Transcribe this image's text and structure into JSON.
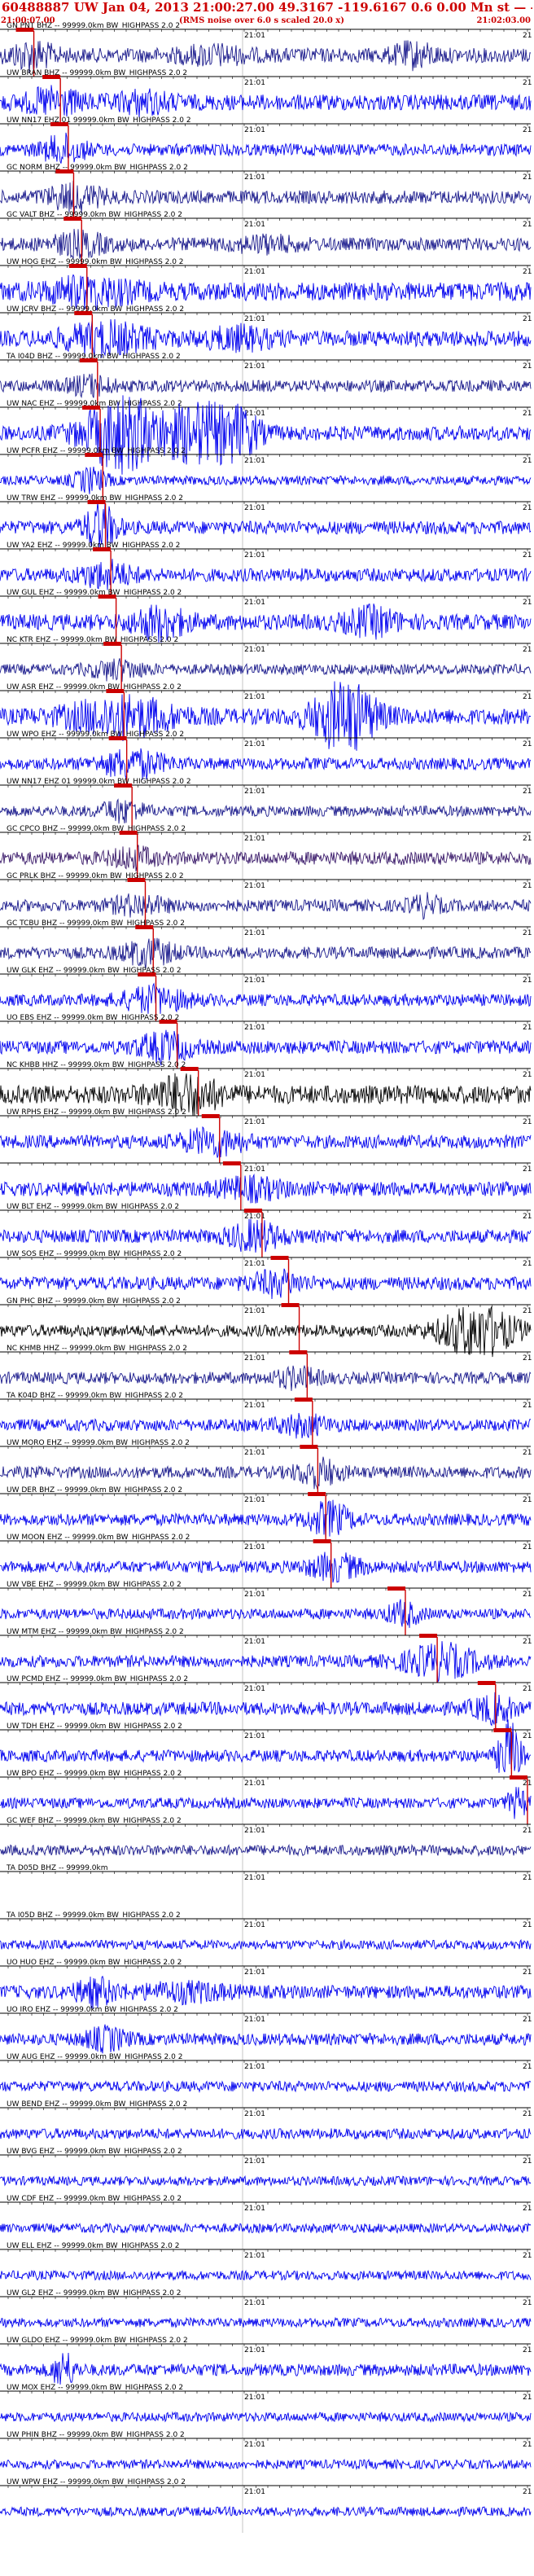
{
  "header": {
    "title": "60488887 UW Jan 04, 2013 21:00:27.00   49.3167 -119.6167  0.6 0.00 Mn st  — — —  -1",
    "time_start": "21:00:07.00",
    "note": "(RMS noise over 6.0 s scaled 20.0 x)",
    "time_end": "21:02:03.00"
  },
  "minute_label": "21:01",
  "minute_label_short": "21",
  "filter_suffix": "99999.0km BW_HIGHPASS  2.0  2",
  "colors": {
    "blue": "#0000ee",
    "navy": "#1a1a8c",
    "purple": "#3a1a6a",
    "black": "#000000",
    "pick": "#cc0000",
    "grid": "#888888"
  },
  "traces": [
    {
      "label": "GN PNT BHZ -- 99999.0km BW_HIGHPASS  2.0  2",
      "color": "navy",
      "amp": 0.55,
      "pick": 0.03,
      "bursts": [
        [
          0.06,
          0.9,
          0.04
        ],
        [
          0.4,
          0.5,
          0.06
        ],
        [
          0.78,
          0.7,
          0.04
        ]
      ],
      "header_only": false
    },
    {
      "label": "UW BRAN BHZ -- 99999.0km BW_HIGHPASS  2.0  2",
      "color": "blue",
      "amp": 0.6,
      "pick": 0.08,
      "bursts": [
        [
          0.1,
          0.8,
          0.05
        ],
        [
          0.27,
          0.6,
          0.05
        ]
      ],
      "header_only": false
    },
    {
      "label": "UW NN17 EHZ 01 99999.0km BW_HIGHPASS  2.0  2",
      "color": "blue",
      "amp": 0.45,
      "pick": 0.095,
      "bursts": [
        [
          0.12,
          0.9,
          0.04
        ]
      ],
      "header_only": false
    },
    {
      "label": "GC NORM BHZ -- 99999.0km BW_HIGHPASS  2.0  2",
      "color": "navy",
      "amp": 0.5,
      "pick": 0.105,
      "bursts": [
        [
          0.14,
          0.8,
          0.05
        ]
      ],
      "header_only": false
    },
    {
      "label": "GC VALT BHZ -- 99999.0km BW_HIGHPASS  2.0  2",
      "color": "navy",
      "amp": 0.5,
      "pick": 0.12,
      "bursts": [
        [
          0.15,
          0.7,
          0.05
        ],
        [
          0.5,
          0.4,
          0.06
        ]
      ],
      "header_only": false
    },
    {
      "label": "UW HOG EHZ -- 99999.0km BW_HIGHPASS  2.0  2",
      "color": "blue",
      "amp": 0.7,
      "pick": 0.13,
      "bursts": [
        [
          0.17,
          0.8,
          0.08
        ]
      ],
      "header_only": false
    },
    {
      "label": "UW JCRV BHZ -- 99999.0km BW_HIGHPASS  2.0  2",
      "color": "blue",
      "amp": 0.6,
      "pick": 0.14,
      "bursts": [
        [
          0.2,
          0.95,
          0.08
        ],
        [
          0.45,
          0.6,
          0.06
        ]
      ],
      "header_only": false
    },
    {
      "label": "TA I04D BHZ -- 99999.0km BW_HIGHPASS  2.0  2",
      "color": "navy",
      "amp": 0.45,
      "pick": 0.15,
      "bursts": [
        [
          0.17,
          0.6,
          0.04
        ]
      ],
      "header_only": false
    },
    {
      "label": "UW NAC EHZ -- 99999.0km BW_HIGHPASS  2.0  2",
      "color": "blue",
      "amp": 0.55,
      "pick": 0.155,
      "bursts": [
        [
          0.23,
          2.6,
          0.07
        ],
        [
          0.37,
          2.0,
          0.06
        ],
        [
          0.45,
          1.5,
          0.04
        ]
      ],
      "header_only": false
    },
    {
      "label": "UW PCFR EHZ -- 99999.0km BW_HIGHPASS  2.0  2",
      "color": "blue",
      "amp": 0.35,
      "pick": 0.16,
      "bursts": [
        [
          0.17,
          0.8,
          0.03
        ]
      ],
      "header_only": false
    },
    {
      "label": "UW TRW EHZ -- 99999.0km BW_HIGHPASS  2.0  2",
      "color": "blue",
      "amp": 0.5,
      "pick": 0.165,
      "bursts": [
        [
          0.19,
          1.6,
          0.03
        ]
      ],
      "header_only": false
    },
    {
      "label": "UW YA2 EHZ -- 99999.0km BW_HIGHPASS  2.0  2",
      "color": "blue",
      "amp": 0.5,
      "pick": 0.175,
      "bursts": [
        [
          0.2,
          0.8,
          0.05
        ]
      ],
      "header_only": false
    },
    {
      "label": "UW GUL EHZ -- 99999.0km BW_HIGHPASS  2.0  2",
      "color": "blue",
      "amp": 0.6,
      "pick": 0.185,
      "bursts": [
        [
          0.3,
          1.0,
          0.05
        ],
        [
          0.7,
          0.8,
          0.05
        ]
      ],
      "header_only": false
    },
    {
      "label": "NC KTR EHZ -- 99999.0km BW_HIGHPASS  2.0  2",
      "color": "navy",
      "amp": 0.4,
      "pick": 0.195,
      "bursts": [
        [
          0.22,
          0.6,
          0.05
        ]
      ],
      "header_only": false
    },
    {
      "label": "UW ASR EHZ -- 99999.0km BW_HIGHPASS  2.0  2",
      "color": "blue",
      "amp": 0.6,
      "pick": 0.2,
      "bursts": [
        [
          0.23,
          1.3,
          0.1
        ],
        [
          0.65,
          2.4,
          0.06
        ]
      ],
      "header_only": false
    },
    {
      "label": "UW WPO EHZ -- 99999.0km BW_HIGHPASS  2.0  2",
      "color": "blue",
      "amp": 0.45,
      "pick": 0.205,
      "bursts": [
        [
          0.25,
          0.9,
          0.06
        ]
      ],
      "header_only": false
    },
    {
      "label": "UW NN17 EHZ 01 99999.0km BW_HIGHPASS  2.0  2",
      "color": "navy",
      "amp": 0.4,
      "pick": 0.215,
      "bursts": [
        [
          0.23,
          0.7,
          0.04
        ]
      ],
      "header_only": false
    },
    {
      "label": "GC CPCO BHZ -- 99999.0km BW_HIGHPASS  2.0  2",
      "color": "purple",
      "amp": 0.5,
      "pick": 0.225,
      "bursts": [
        [
          0.25,
          0.6,
          0.04
        ]
      ],
      "header_only": false
    },
    {
      "label": "GC PRLK BHZ -- 99999.0km BW_HIGHPASS  2.0  2",
      "color": "navy",
      "amp": 0.45,
      "pick": 0.24,
      "bursts": [
        [
          0.26,
          0.6,
          0.05
        ],
        [
          0.8,
          0.6,
          0.03
        ]
      ],
      "header_only": false
    },
    {
      "label": "GC TCBU BHZ -- 99999.0km BW_HIGHPASS  2.0  2",
      "color": "navy",
      "amp": 0.45,
      "pick": 0.255,
      "bursts": [
        [
          0.28,
          0.8,
          0.05
        ]
      ],
      "header_only": false
    },
    {
      "label": "UW GLK EHZ -- 99999.0km BW_HIGHPASS  2.0  2",
      "color": "blue",
      "amp": 0.45,
      "pick": 0.26,
      "bursts": [
        [
          0.29,
          0.8,
          0.06
        ]
      ],
      "header_only": false
    },
    {
      "label": "UO EBS EHZ -- 99999.0km BW_HIGHPASS  2.0  2",
      "color": "blue",
      "amp": 0.5,
      "pick": 0.3,
      "bursts": [
        [
          0.31,
          0.9,
          0.05
        ]
      ],
      "header_only": false
    },
    {
      "label": "NC KHBB HHZ -- 99999.0km BW_HIGHPASS  2.0  2",
      "color": "black",
      "amp": 0.7,
      "pick": 0.34,
      "bursts": [
        [
          0.35,
          1.2,
          0.06
        ]
      ],
      "header_only": false
    },
    {
      "label": "UW RPHS EHZ -- 99999.0km BW_HIGHPASS  2.0  2",
      "color": "blue",
      "amp": 0.5,
      "pick": 0.38,
      "bursts": [
        [
          0.4,
          0.8,
          0.06
        ]
      ],
      "header_only": false
    },
    {
      "label": "",
      "color": "blue",
      "amp": 0.55,
      "pick": 0.42,
      "bursts": [
        [
          0.47,
          0.6,
          0.06
        ]
      ],
      "header_only": false
    },
    {
      "label": "UW BLT EHZ -- 99999.0km BW_HIGHPASS  2.0  2",
      "color": "blue",
      "amp": 0.5,
      "pick": 0.46,
      "bursts": [
        [
          0.48,
          0.9,
          0.05
        ]
      ],
      "header_only": false
    },
    {
      "label": "UW SOS EHZ -- 99999.0km BW_HIGHPASS  2.0  2",
      "color": "blue",
      "amp": 0.5,
      "pick": 0.51,
      "bursts": [
        [
          0.52,
          0.7,
          0.05
        ]
      ],
      "header_only": false
    },
    {
      "label": "GN PHC BHZ -- 99999.0km BW_HIGHPASS  2.0  2",
      "color": "black",
      "amp": 0.45,
      "pick": 0.53,
      "bursts": [
        [
          0.9,
          1.8,
          0.07
        ]
      ],
      "header_only": false
    },
    {
      "label": "NC KHMB HHZ -- 99999.0km BW_HIGHPASS  2.0  2",
      "color": "navy",
      "amp": 0.45,
      "pick": 0.545,
      "bursts": [
        [
          0.56,
          0.6,
          0.04
        ]
      ],
      "header_only": false
    },
    {
      "label": "TA K04D BHZ -- 99999.0km BW_HIGHPASS  2.0  2",
      "color": "blue",
      "amp": 0.45,
      "pick": 0.555,
      "bursts": [
        [
          0.57,
          0.6,
          0.05
        ]
      ],
      "header_only": false
    },
    {
      "label": "UW MORO EHZ -- 99999.0km BW_HIGHPASS  2.0  2",
      "color": "navy",
      "amp": 0.45,
      "pick": 0.565,
      "bursts": [
        [
          0.6,
          0.9,
          0.04
        ]
      ],
      "header_only": false
    },
    {
      "label": "UW DER BHZ -- 99999.0km BW_HIGHPASS  2.0  2",
      "color": "blue",
      "amp": 0.45,
      "pick": 0.58,
      "bursts": [
        [
          0.62,
          1.1,
          0.04
        ]
      ],
      "header_only": false
    },
    {
      "label": "UW MOON EHZ -- 99999.0km BW_HIGHPASS  2.0  2",
      "color": "blue",
      "amp": 0.45,
      "pick": 0.59,
      "bursts": [
        [
          0.63,
          0.8,
          0.05
        ]
      ],
      "header_only": false
    },
    {
      "label": "UW VBE EHZ -- 99999.0km BW_HIGHPASS  2.0  2",
      "color": "blue",
      "amp": 0.4,
      "pick": 0.73,
      "bursts": [
        [
          0.76,
          0.8,
          0.03
        ]
      ],
      "header_only": false
    },
    {
      "label": "UW MTM EHZ -- 99999.0km BW_HIGHPASS  2.0  2",
      "color": "blue",
      "amp": 0.45,
      "pick": 0.79,
      "bursts": [
        [
          0.83,
          1.1,
          0.07
        ]
      ],
      "header_only": false
    },
    {
      "label": "UW PCMD EHZ -- 99999.0km BW_HIGHPASS  2.0  2",
      "color": "blue",
      "amp": 0.5,
      "pick": 0.9,
      "bursts": [
        [
          0.93,
          0.8,
          0.04
        ]
      ],
      "header_only": false
    },
    {
      "label": "UW TDH EHZ -- 99999.0km BW_HIGHPASS  2.0  2",
      "color": "blue",
      "amp": 0.45,
      "pick": 0.93,
      "bursts": [
        [
          0.96,
          2.4,
          0.02
        ]
      ],
      "header_only": false
    },
    {
      "label": "UW BPO EHZ -- 99999.0km BW_HIGHPASS  2.0  2",
      "color": "blue",
      "amp": 0.4,
      "pick": 0.96,
      "bursts": [
        [
          0.975,
          0.9,
          0.02
        ]
      ],
      "header_only": false
    },
    {
      "label": "GC WEF BHZ -- 99999.0km BW_HIGHPASS  2.0  2",
      "color": "navy",
      "amp": 0.4,
      "pick": -1,
      "bursts": [],
      "header_only": false
    },
    {
      "label": "TA D05D BHZ -- 99999.0km",
      "color": "navy",
      "amp": 0.0,
      "pick": -1,
      "bursts": [],
      "header_only": true
    },
    {
      "label": "TA I05D BHZ -- 99999.0km BW_HIGHPASS  2.0  2",
      "color": "blue",
      "amp": 0.35,
      "pick": -1,
      "bursts": [],
      "header_only": false
    },
    {
      "label": "UO HUO EHZ -- 99999.0km BW_HIGHPASS  2.0  2",
      "color": "blue",
      "amp": 0.5,
      "pick": -1,
      "bursts": [
        [
          0.18,
          0.8,
          0.04
        ],
        [
          0.35,
          0.5,
          0.08
        ]
      ],
      "header_only": false
    },
    {
      "label": "UO IRO EHZ -- 99999.0km BW_HIGHPASS  2.0  2",
      "color": "blue",
      "amp": 0.45,
      "pick": -1,
      "bursts": [
        [
          0.2,
          0.7,
          0.04
        ]
      ],
      "header_only": false
    },
    {
      "label": "UW AUG EHZ -- 99999.0km BW_HIGHPASS  2.0  2",
      "color": "blue",
      "amp": 0.4,
      "pick": -1,
      "bursts": [],
      "header_only": false
    },
    {
      "label": "UW BEND EHZ -- 99999.0km BW_HIGHPASS  2.0  2",
      "color": "blue",
      "amp": 0.4,
      "pick": -1,
      "bursts": [],
      "header_only": false
    },
    {
      "label": "UW BVG EHZ -- 99999.0km BW_HIGHPASS  2.0  2",
      "color": "blue",
      "amp": 0.35,
      "pick": -1,
      "bursts": [],
      "header_only": false
    },
    {
      "label": "UW CDF EHZ -- 99999.0km BW_HIGHPASS  2.0  2",
      "color": "blue",
      "amp": 0.35,
      "pick": -1,
      "bursts": [],
      "header_only": false
    },
    {
      "label": "UW ELL EHZ -- 99999.0km BW_HIGHPASS  2.0  2",
      "color": "blue",
      "amp": 0.35,
      "pick": -1,
      "bursts": [],
      "header_only": false
    },
    {
      "label": "UW GL2 EHZ -- 99999.0km BW_HIGHPASS  2.0  2",
      "color": "blue",
      "amp": 0.35,
      "pick": -1,
      "bursts": [],
      "header_only": false
    },
    {
      "label": "UW GLDO EHZ -- 99999.0km BW_HIGHPASS  2.0  2",
      "color": "blue",
      "amp": 0.45,
      "pick": -1,
      "bursts": [
        [
          0.12,
          1.2,
          0.02
        ]
      ],
      "header_only": false
    },
    {
      "label": "UW MOX EHZ -- 99999.0km BW_HIGHPASS  2.0  2",
      "color": "blue",
      "amp": 0.35,
      "pick": -1,
      "bursts": [],
      "header_only": false
    },
    {
      "label": "UW PHIN BHZ -- 99999.0km BW_HIGHPASS  2.0  2",
      "color": "blue",
      "amp": 0.35,
      "pick": -1,
      "bursts": [],
      "header_only": false
    },
    {
      "label": "UW WPW EHZ -- 99999.0km BW_HIGHPASS  2.0  2",
      "color": "blue",
      "amp": 0.35,
      "pick": -1,
      "bursts": [],
      "header_only": false
    }
  ]
}
